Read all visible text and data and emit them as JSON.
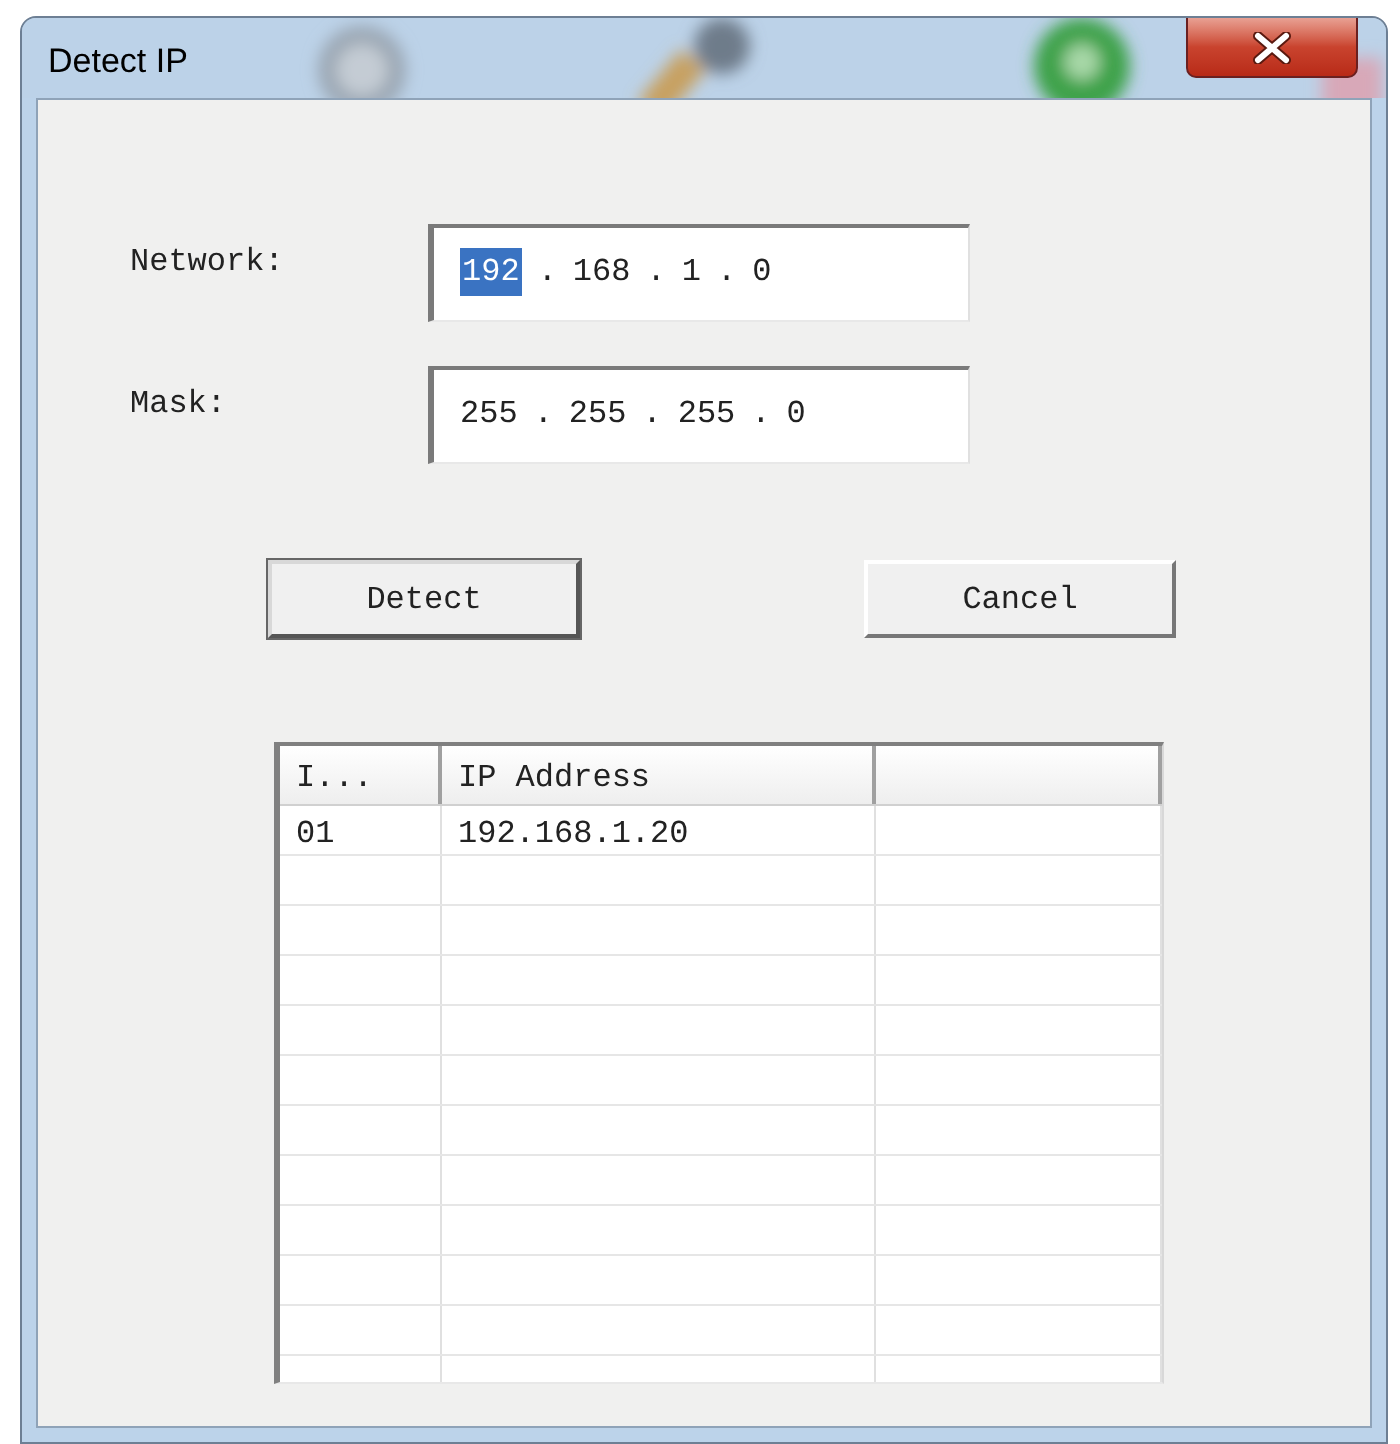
{
  "window": {
    "title": "Detect IP"
  },
  "fields": [
    {
      "label": "Network:",
      "segments": [
        {
          "text": "192",
          "selected": true
        },
        {
          "text": ".",
          "selected": false
        },
        {
          "text": "168",
          "selected": false
        },
        {
          "text": ".",
          "selected": false
        },
        {
          "text": "1",
          "selected": false
        },
        {
          "text": ".",
          "selected": false
        },
        {
          "text": "0",
          "selected": false
        }
      ]
    },
    {
      "label": "Mask:",
      "segments": [
        {
          "text": "255",
          "selected": false
        },
        {
          "text": ".",
          "selected": false
        },
        {
          "text": "255",
          "selected": false
        },
        {
          "text": ".",
          "selected": false
        },
        {
          "text": "255",
          "selected": false
        },
        {
          "text": ".",
          "selected": false
        },
        {
          "text": "0",
          "selected": false
        }
      ]
    }
  ],
  "buttons": [
    {
      "label": "Detect",
      "default": true
    },
    {
      "label": "Cancel",
      "default": false
    }
  ],
  "table": {
    "columns": [
      "I...",
      "IP Address"
    ],
    "rows": [
      {
        "id": "01",
        "ip_address": "192.168.1.20"
      }
    ]
  }
}
